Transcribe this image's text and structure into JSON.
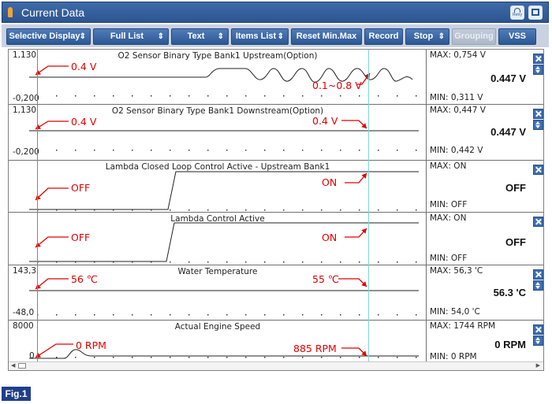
{
  "window": {
    "title": "Current Data",
    "refresh_label": "Retry"
  },
  "toolbar": {
    "buttons": [
      {
        "label": "Selective Display",
        "dropdown": true,
        "enabled": true
      },
      {
        "label": "Full List",
        "dropdown": true,
        "enabled": true
      },
      {
        "label": "Text",
        "dropdown": true,
        "enabled": true
      },
      {
        "label": "Items List",
        "dropdown": true,
        "enabled": true
      },
      {
        "label": "Reset Min.Max",
        "dropdown": false,
        "enabled": true
      },
      {
        "label": "Record",
        "dropdown": false,
        "enabled": true
      },
      {
        "label": "Stop",
        "dropdown": true,
        "enabled": true
      },
      {
        "label": "Grouping",
        "dropdown": false,
        "enabled": false
      },
      {
        "label": "VSS",
        "dropdown": false,
        "enabled": true
      }
    ]
  },
  "colors": {
    "accent": "#2d5792",
    "annotation": "#e00000",
    "cursor_red": "#ff5050",
    "cursor_cyan": "#7fd6d6"
  },
  "icons": {
    "refresh": "refresh-icon",
    "window": "window-icon",
    "close": "close-icon",
    "updown": "up-down-icon"
  },
  "panels": [
    {
      "title": "O2 Sensor Binary Type Bank1 Upstream(Option)",
      "ymax": "1,130",
      "ymin": "-0,200",
      "max": "MAX: 0,754 V",
      "min": "MIN: 0,311 V",
      "current": "0.447 V",
      "updown": true,
      "annotations": [
        "0.4 V",
        "0.1~0.8 V"
      ]
    },
    {
      "title": "O2 Sensor Binary Type Bank1 Downstream(Option)",
      "ymax": "1,130",
      "ymin": "-0,200",
      "max": "MAX: 0,447 V",
      "min": "MIN: 0,442 V",
      "current": "0.447 V",
      "updown": true,
      "annotations": [
        "0.4 V",
        "0.4 V"
      ]
    },
    {
      "title": "Lambda Closed Loop Control Active - Upstream Bank1",
      "ymax": "",
      "ymin": "",
      "max": "MAX: ON",
      "min": "MIN: OFF",
      "current": "OFF",
      "updown": false,
      "annotations": [
        "OFF",
        "ON"
      ]
    },
    {
      "title": "Lambda Control Active",
      "ymax": "",
      "ymin": "",
      "max": "MAX: ON",
      "min": "MIN: OFF",
      "current": "OFF",
      "updown": false,
      "annotations": [
        "OFF",
        "ON"
      ]
    },
    {
      "title": "Water Temperature",
      "ymax": "143,3",
      "ymin": "-48,0",
      "max": "MAX:  56,3 'C",
      "min": "MIN:  54,0 'C",
      "current": "56.3 'C",
      "updown": true,
      "annotations": [
        "56 ℃",
        "55 ℃"
      ]
    },
    {
      "title": "Actual Engine Speed",
      "ymax": "8000",
      "ymin": "0",
      "max": "MAX:  1744 RPM",
      "min": "MIN:     0 RPM",
      "current": "0 RPM",
      "updown": true,
      "annotations": [
        "0 RPM",
        "885 RPM"
      ]
    }
  ],
  "footer": {
    "figure_label": "Fig.1"
  }
}
